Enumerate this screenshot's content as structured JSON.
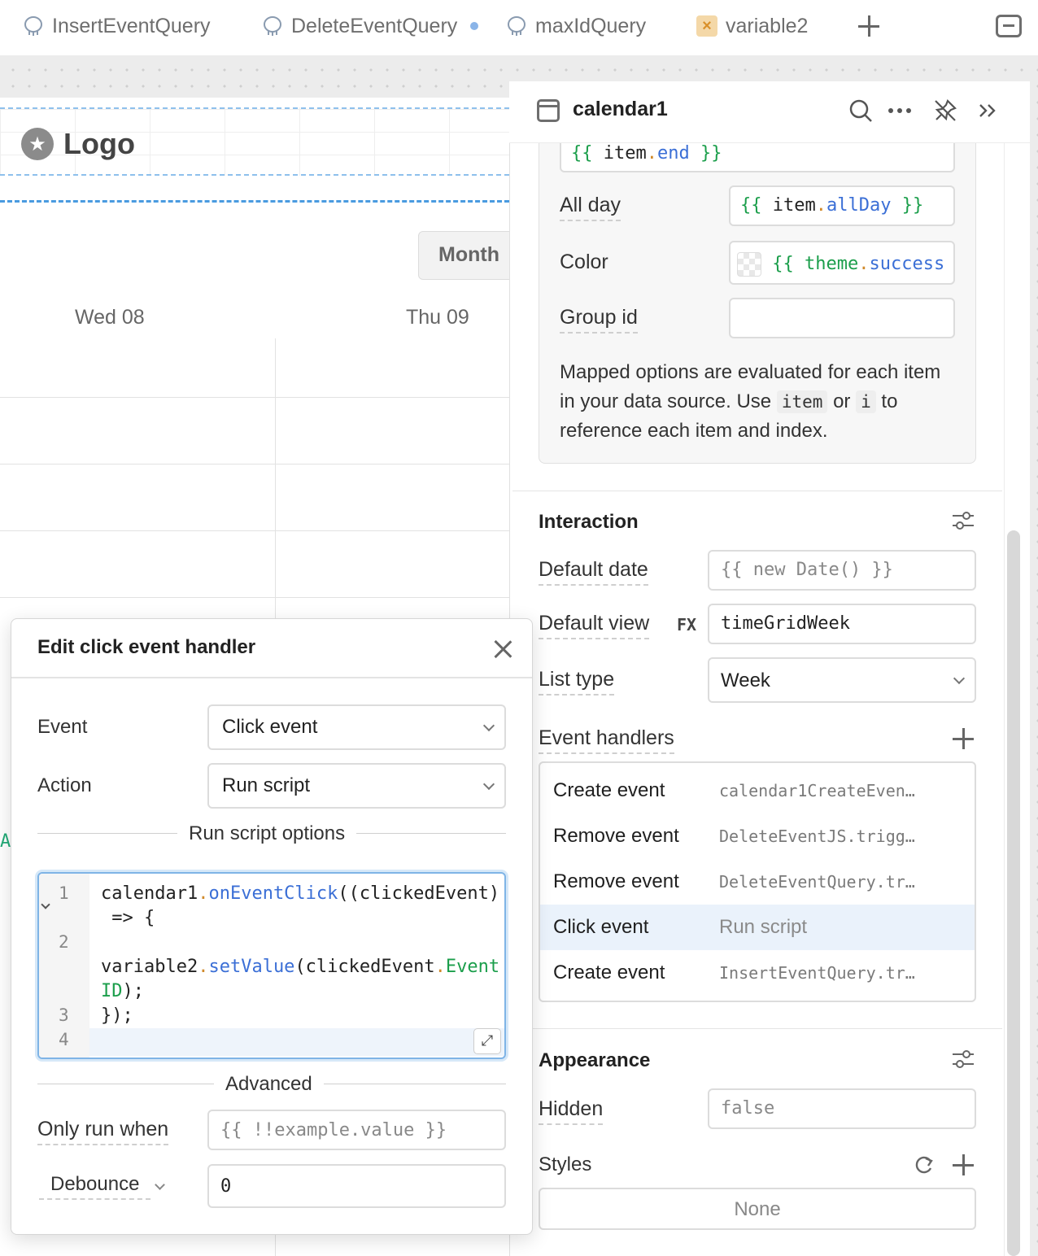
{
  "tabs": [
    {
      "label": "InsertEventQuery",
      "icon": "postgres-icon"
    },
    {
      "label": "DeleteEventQuery",
      "icon": "postgres-icon",
      "unsaved": true
    },
    {
      "label": "maxIdQuery",
      "icon": "postgres-icon"
    },
    {
      "label": "variable2",
      "icon": "variable-icon"
    }
  ],
  "canvas": {
    "logo_text": "Logo",
    "view_button": "Month",
    "day_headers": [
      "Wed 08",
      "Thu 09"
    ],
    "edge_char": "A"
  },
  "inspector": {
    "title": "calendar1",
    "mapped": {
      "end_value": {
        "open": "{{",
        "obj": "item",
        "dot": ".",
        "prop": "end",
        "close": "}}"
      },
      "all_day_label": "All day",
      "all_day_value": {
        "open": "{{",
        "obj": "item",
        "dot": ".",
        "prop": "allDay",
        "close": "}}"
      },
      "color_label": "Color",
      "color_value": {
        "open": "{{",
        "obj": "theme",
        "dot": ".",
        "prop": "success"
      },
      "group_id_label": "Group id",
      "group_id_value": "",
      "note_part1": "Mapped options are evaluated for each item in your data source. Use",
      "note_code1": "item",
      "note_or": "or",
      "note_code2": "i",
      "note_part2": "to reference each item and index."
    },
    "interaction": {
      "title": "Interaction",
      "default_date_label": "Default date",
      "default_date_value": "{{ new Date() }}",
      "default_view_label": "Default view",
      "fx_label": "FX",
      "default_view_value": "timeGridWeek",
      "list_type_label": "List type",
      "list_type_value": "Week",
      "event_handlers_label": "Event handlers",
      "handlers": [
        {
          "event": "Create event",
          "action": "calendar1CreateEven…"
        },
        {
          "event": "Remove event",
          "action": "DeleteEventJS.trigg…"
        },
        {
          "event": "Remove event",
          "action": "DeleteEventQuery.tr…"
        },
        {
          "event": "Click event",
          "action": "Run script",
          "selected": true
        },
        {
          "event": "Create event",
          "action": "InsertEventQuery.tr…"
        }
      ]
    },
    "appearance": {
      "title": "Appearance",
      "hidden_label": "Hidden",
      "hidden_value": "false",
      "styles_label": "Styles",
      "styles_value": "None"
    }
  },
  "popover": {
    "title": "Edit click event handler",
    "event_label": "Event",
    "event_value": "Click event",
    "action_label": "Action",
    "action_value": "Run script",
    "options_title": "Run script options",
    "code": {
      "line_numbers": [
        "1",
        "2",
        "3",
        "4"
      ],
      "l1_obj": "calendar1",
      "l1_dot": ".",
      "l1_fn": "onEventClick",
      "l1_rest": "((clickedEvent)",
      "l1_cont": " => {",
      "l2_obj": "variable2",
      "l2_dot": ".",
      "l2_fn": "setValue",
      "l2_arg": "(clickedEvent",
      "l2_dot2": ".",
      "l2_prop": "Event",
      "l2_prop_cont": "ID",
      "l2_end": ");",
      "l3": "});",
      "l4": ""
    },
    "advanced_title": "Advanced",
    "only_run_label": "Only run when",
    "only_run_placeholder": "{{ !!example.value }}",
    "debounce_label": "Debounce",
    "debounce_value": "0"
  }
}
